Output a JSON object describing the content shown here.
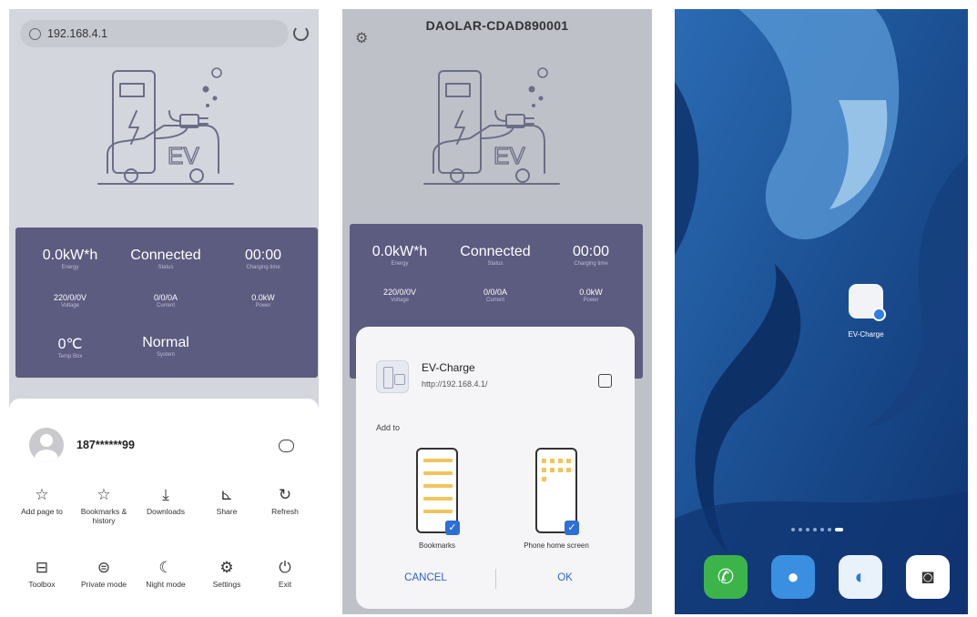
{
  "panel1": {
    "url": "192.168.4.1",
    "stats": [
      {
        "value": "0.0kW*h",
        "label": "Energy"
      },
      {
        "value": "Connected",
        "label": "Status"
      },
      {
        "value": "00:00",
        "label": "Charging time"
      },
      {
        "value": "220/0/0V",
        "label": "Voltage"
      },
      {
        "value": "0/0/0A",
        "label": "Current"
      },
      {
        "value": "0.0kW",
        "label": "Power"
      },
      {
        "value": "0℃",
        "label": "Temp Box"
      },
      {
        "value": "Normal",
        "label": "System"
      }
    ],
    "user": "187******99",
    "menu": [
      {
        "label": "Add page to",
        "icon": "☆"
      },
      {
        "label": "Bookmarks & history",
        "icon": "☆"
      },
      {
        "label": "Downloads",
        "icon": "⤓"
      },
      {
        "label": "Share",
        "icon": "⊾"
      },
      {
        "label": "Refresh",
        "icon": "↻"
      },
      {
        "label": "Toolbox",
        "icon": "⊟"
      },
      {
        "label": "Private mode",
        "icon": "⊜"
      },
      {
        "label": "Night mode",
        "icon": "☾"
      },
      {
        "label": "Settings",
        "icon": "⚙"
      },
      {
        "label": "Exit",
        "icon": "⏻"
      }
    ]
  },
  "panel2": {
    "title": "DAOLAR-CDAD890001",
    "stats": [
      {
        "value": "0.0kW*h",
        "label": "Energy"
      },
      {
        "value": "Connected",
        "label": "Status"
      },
      {
        "value": "00:00",
        "label": "Charging time"
      },
      {
        "value": "220/0/0V",
        "label": "Voltage"
      },
      {
        "value": "0/0/0A",
        "label": "Current"
      },
      {
        "value": "0.0kW",
        "label": "Power"
      }
    ],
    "dialog": {
      "app_name": "EV-Charge",
      "app_url": "http://192.168.4.1/",
      "add_to": "Add to",
      "option_bookmarks": "Bookmarks",
      "option_home": "Phone home screen",
      "cancel": "CANCEL",
      "ok": "OK"
    }
  },
  "panel3": {
    "app_label": "EV-Charge",
    "dock": [
      {
        "name": "phone",
        "color": "#3cb44a",
        "icon": "✆"
      },
      {
        "name": "messages",
        "color": "#3a8fe0",
        "icon": "●"
      },
      {
        "name": "browser",
        "color": "#2a7ad8",
        "icon": "◐"
      },
      {
        "name": "camera",
        "color": "#ffffff",
        "icon": "◙"
      }
    ]
  }
}
